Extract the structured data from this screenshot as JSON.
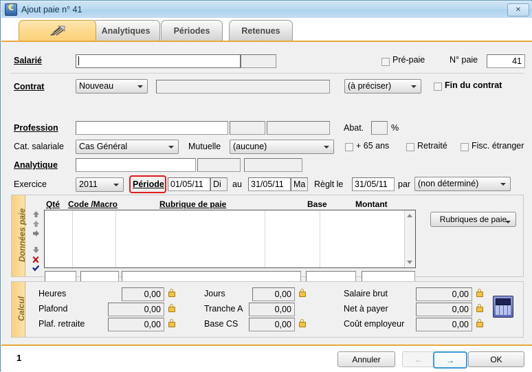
{
  "window": {
    "title": "Ajout paie n° 41",
    "icon": "euro-app-icon",
    "close_label": "✕",
    "accent": "#e8a93b",
    "titlebar_color": "#bcd9f0"
  },
  "tabs": [
    {
      "label": "",
      "icon": "quill-icon",
      "active": true
    },
    {
      "label": "Analytiques",
      "active": false
    },
    {
      "label": "Périodes",
      "active": false
    },
    {
      "label": "Retenues",
      "active": false
    }
  ],
  "form": {
    "salarie": {
      "label": "Salarié",
      "value": "",
      "code_value": ""
    },
    "pre_paie": {
      "label": "Pré-paie",
      "checked": false
    },
    "no_paie": {
      "label": "N° paie",
      "value": "41"
    },
    "contrat": {
      "label": "Contrat",
      "type_value": "Nouveau",
      "name_value": "",
      "precision_value": "(à préciser)",
      "fin_contrat": {
        "label": "Fin du contrat",
        "checked": false
      }
    },
    "cat_salariale": {
      "label": "Cat. salariale",
      "value": "Cas Général"
    },
    "mutuelle": {
      "label": "Mutuelle",
      "value": "(aucune)"
    },
    "plus65": {
      "label": "+ 65 ans",
      "checked": false
    },
    "retraite": {
      "label": "Retraité",
      "checked": false
    },
    "fisc_etranger": {
      "label": "Fisc. étranger",
      "checked": false
    },
    "profession": {
      "label": "Profession",
      "value": "",
      "code_value": "",
      "extra_value": ""
    },
    "abattement": {
      "label": "Abat.",
      "value": "",
      "unit": "%"
    },
    "analytique": {
      "label": "Analytique",
      "value": "",
      "code_value": "",
      "extra_value": ""
    },
    "exercice": {
      "label": "Exercice",
      "value": "2011"
    },
    "periode": {
      "label": "Période",
      "highlighted": true,
      "highlight_color": "#e01b1b",
      "start_date": "01/05/11",
      "start_day": "Di",
      "to_label": "au",
      "end_date": "31/05/11",
      "end_day": "Ma"
    },
    "reglement": {
      "label": "Règlt le",
      "date": "31/05/11",
      "by_label": "par",
      "mode": "(non déterminé)"
    }
  },
  "donnees_paie": {
    "section_label": "Données paie",
    "columns": [
      "Qté",
      "Code /Macro",
      "Rubrique de paie",
      "Base",
      "Montant"
    ],
    "rows": [],
    "toolbar_icons": [
      "move-top-icon",
      "move-up-icon",
      "move-prev-icon",
      "move-down-icon",
      "delete-row-icon",
      "validate-row-icon"
    ],
    "entry_row": {
      "qte": "",
      "code": "",
      "rubrique": "",
      "base": "",
      "montant": ""
    },
    "rubriques_button": "Rubriques de paie"
  },
  "calcul": {
    "section_label": "Calcul",
    "fields": [
      {
        "label": "Heures",
        "value": "0,00",
        "locked": true,
        "col": 1
      },
      {
        "label": "Plafond",
        "value": "0,00",
        "locked": true,
        "col": 1
      },
      {
        "label": "Plaf. retraite",
        "value": "0,00",
        "locked": true,
        "col": 1
      },
      {
        "label": "Jours",
        "value": "0,00",
        "locked": true,
        "col": 2
      },
      {
        "label": "Tranche A",
        "value": "0,00",
        "locked": false,
        "col": 2
      },
      {
        "label": "Base CS",
        "value": "0,00",
        "locked": true,
        "col": 2
      },
      {
        "label": "Salaire brut",
        "value": "0,00",
        "locked": true,
        "col": 3
      },
      {
        "label": "Net à payer",
        "value": "0,00",
        "locked": true,
        "col": 3
      },
      {
        "label": "Coût employeur",
        "value": "0,00",
        "locked": true,
        "col": 3
      }
    ],
    "calculator_icon": "calculator-icon"
  },
  "footer": {
    "page_number": "1",
    "cancel_label": "Annuler",
    "prev_label": "←",
    "next_label": "→",
    "ok_label": "OK"
  }
}
